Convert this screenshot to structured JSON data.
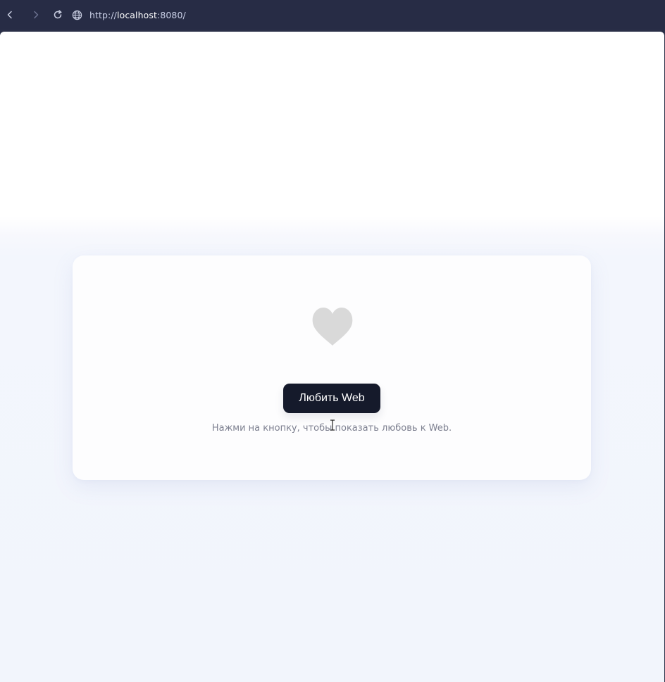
{
  "browser": {
    "url_scheme": "http://",
    "url_host": "localhost",
    "url_rest": ":8080/",
    "icons": {
      "back": "chevron-left-icon",
      "forward": "chevron-right-icon",
      "reload": "reload-icon",
      "site": "globe-icon"
    }
  },
  "page": {
    "heart_icon": "heart-icon",
    "heart_color": "#d9d9d9",
    "button_label": "Любить Web",
    "hint_text": "Нажми на кнопку, чтобы показать любовь к Web."
  }
}
